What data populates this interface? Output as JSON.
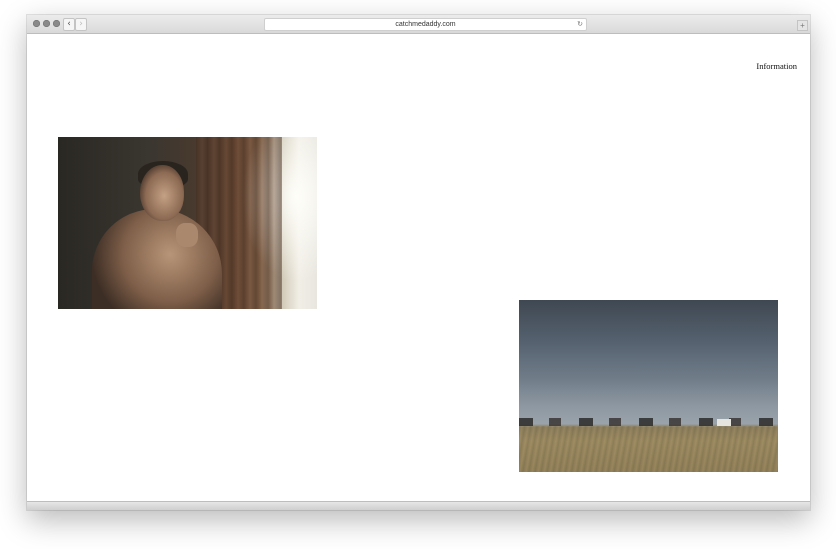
{
  "browser": {
    "url": "catchmedaddy.com",
    "back_glyph": "‹",
    "forward_glyph": "›",
    "reload_glyph": "↻",
    "new_tab_glyph": "+"
  },
  "page": {
    "nav": {
      "information_label": "Information"
    },
    "photos": [
      {
        "name": "photo-portrait-window",
        "subject": "shirtless man leaning by a window curtain"
      },
      {
        "name": "photo-landscape-field",
        "subject": "grass field under dark cloudy sky with houses on horizon"
      }
    ]
  }
}
